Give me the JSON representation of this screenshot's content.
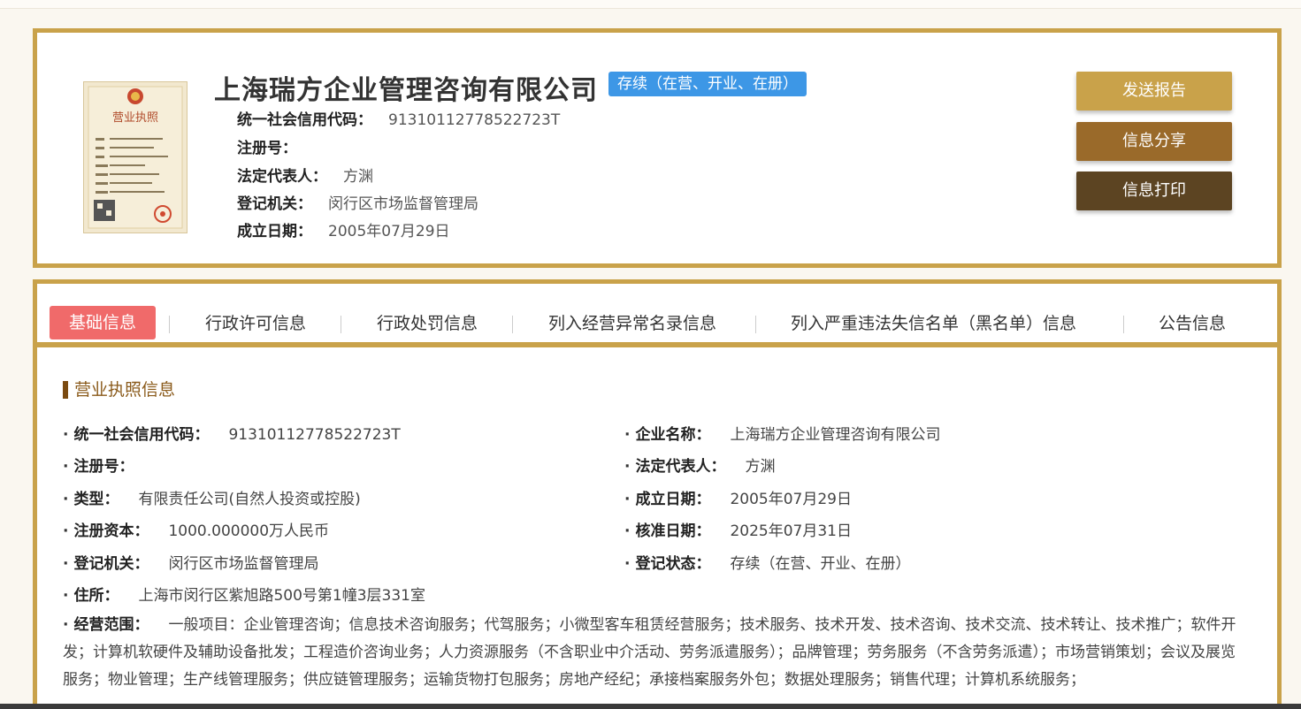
{
  "header": {
    "company_name": "上海瑞方企业管理咨询有限公司",
    "status": "存续（在营、开业、在册）",
    "fields": [
      {
        "label": "统一社会信用代码：",
        "value": "91310112778522723T"
      },
      {
        "label": "注册号：",
        "value": ""
      },
      {
        "label": "法定代表人：",
        "value": "方渊"
      },
      {
        "label": "登记机关：",
        "value": "闵行区市场监督管理局"
      },
      {
        "label": "成立日期：",
        "value": "2005年07月29日"
      }
    ],
    "buttons": {
      "send": "发送报告",
      "share": "信息分享",
      "print": "信息打印"
    },
    "license_image": {
      "title": "营业执照"
    }
  },
  "tabs": [
    {
      "label": "基础信息",
      "active": true
    },
    {
      "label": "行政许可信息"
    },
    {
      "label": "行政处罚信息"
    },
    {
      "label": "列入经营异常名录信息"
    },
    {
      "label": "列入严重违法失信名单（黑名单）信息"
    },
    {
      "label": "公告信息"
    }
  ],
  "section": {
    "title": "营业执照信息",
    "left": [
      {
        "label": "统一社会信用代码：",
        "value": "91310112778522723T"
      },
      {
        "label": "注册号：",
        "value": ""
      },
      {
        "label": "类型：",
        "value": "有限责任公司(自然人投资或控股)"
      },
      {
        "label": "注册资本：",
        "value": "1000.000000万人民币"
      },
      {
        "label": "登记机关：",
        "value": "闵行区市场监督管理局"
      },
      {
        "label": "住所：",
        "value": "上海市闵行区紫旭路500号第1幢3层331室"
      }
    ],
    "right": [
      {
        "label": "企业名称：",
        "value": "上海瑞方企业管理咨询有限公司"
      },
      {
        "label": "法定代表人：",
        "value": "方渊"
      },
      {
        "label": "成立日期：",
        "value": "2005年07月29日"
      },
      {
        "label": "核准日期：",
        "value": "2025年07月31日"
      },
      {
        "label": "登记状态：",
        "value": "存续（在营、开业、在册）"
      }
    ],
    "scope": {
      "label": "经营范围：",
      "value": "一般项目：企业管理咨询；信息技术咨询服务；代驾服务；小微型客车租赁经营服务；技术服务、技术开发、技术咨询、技术交流、技术转让、技术推广；软件开发；计算机软硬件及辅助设备批发；工程造价咨询业务；人力资源服务（不含职业中介活动、劳务派遣服务）；品牌管理；劳务服务（不含劳务派遣）；市场营销策划；会议及展览服务；物业管理；生产线管理服务；供应链管理服务；运输货物打包服务；房地产经纪；承接档案服务外包；数据处理服务；销售代理；计算机系统服务；"
    }
  },
  "colors": {
    "border_gold": "#c9a24a",
    "badge_blue": "#3d97e6",
    "active_tab": "#f06a6a"
  }
}
